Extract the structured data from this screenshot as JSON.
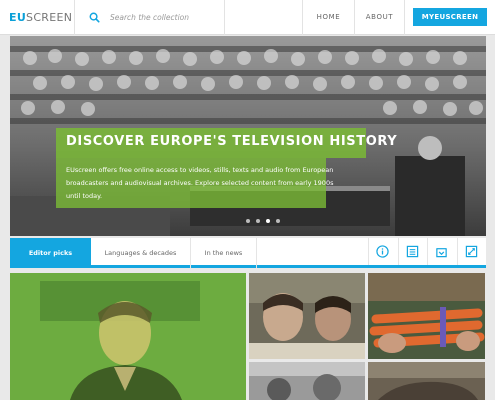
{
  "header": {
    "logo_primary": "EU",
    "logo_secondary": "SCREEN",
    "search_placeholder": "Search the collection",
    "nav": {
      "home": "HOME",
      "about": "ABOUT",
      "my": "MYEUSCREEN"
    }
  },
  "hero": {
    "title": "DISCOVER EUROPE'S TELEVISION HISTORY",
    "description": "EUscreen offers free online access to videos, stills, texts and audio from European broadcasters and audiovisual archives. Explore selected content from early 1900s until today.",
    "slides_count": 4,
    "active_slide": 3
  },
  "tabs": {
    "items": [
      "Editor picks",
      "Languages & decades",
      "In the news"
    ],
    "active": 0,
    "icons": [
      "info-icon",
      "list-icon",
      "download-icon",
      "fullscreen-icon"
    ]
  },
  "colors": {
    "accent": "#14a6e0",
    "green_overlay": "#7aba36"
  }
}
